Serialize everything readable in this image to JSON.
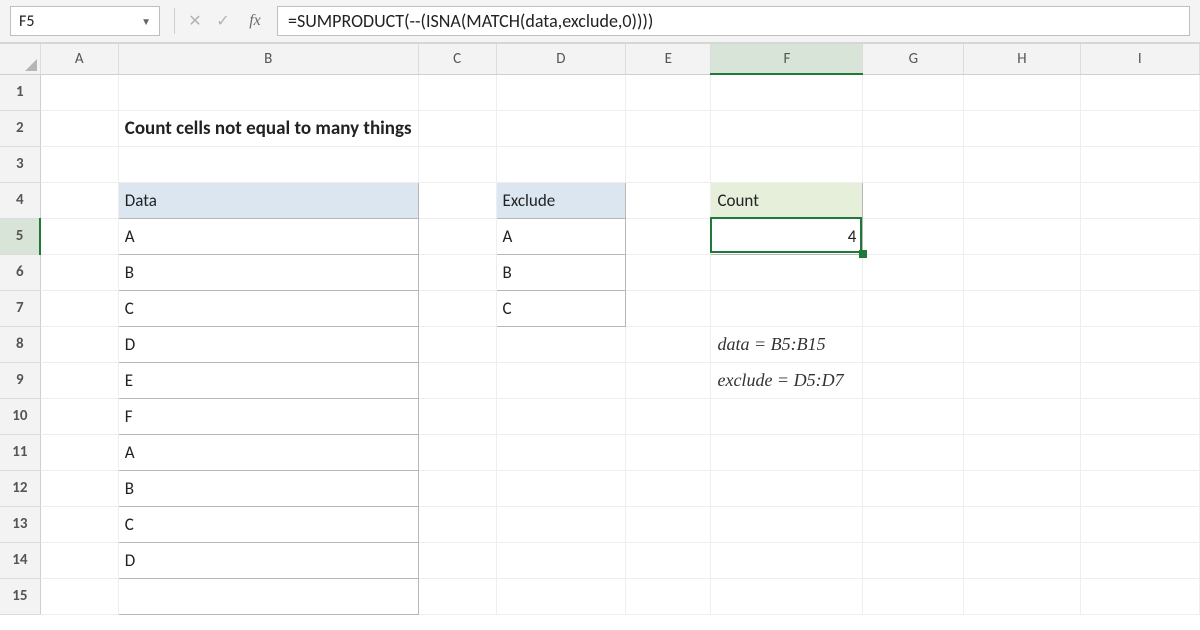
{
  "name_box": "F5",
  "formula": "=SUMPRODUCT(--(ISNA(MATCH(data,exclude,0))))",
  "columns": [
    "A",
    "B",
    "C",
    "D",
    "E",
    "F",
    "G",
    "H",
    "I"
  ],
  "active_col": "F",
  "active_row": 5,
  "title": "Count cells not equal to many things",
  "headers": {
    "data": "Data",
    "exclude": "Exclude",
    "count": "Count"
  },
  "data_col": [
    "A",
    "B",
    "C",
    "D",
    "E",
    "F",
    "A",
    "B",
    "C",
    "D"
  ],
  "exclude_col": [
    "A",
    "B",
    "C"
  ],
  "count_value": "4",
  "notes": {
    "data": "data = B5:B15",
    "exclude": "exclude = D5:D7"
  },
  "chart_data": {
    "type": "table",
    "title": "Count cells not equal to many things",
    "series": [
      {
        "name": "Data",
        "values": [
          "A",
          "B",
          "C",
          "D",
          "E",
          "F",
          "A",
          "B",
          "C",
          "D"
        ]
      },
      {
        "name": "Exclude",
        "values": [
          "A",
          "B",
          "C"
        ]
      },
      {
        "name": "Count",
        "values": [
          4
        ]
      }
    ],
    "formula": "=SUMPRODUCT(--(ISNA(MATCH(data,exclude,0))))",
    "named_ranges": {
      "data": "B5:B15",
      "exclude": "D5:D7"
    }
  }
}
